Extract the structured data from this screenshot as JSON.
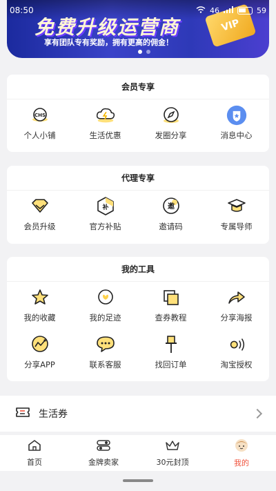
{
  "status_bar": {
    "time": "08:50",
    "signal_text": "46",
    "battery": "59"
  },
  "banner": {
    "title": "免费升级运营商",
    "subtitle": "享有团队专有奖励，拥有更高的佣金！",
    "badge": "VIP"
  },
  "sections": [
    {
      "title": "会员专享",
      "items": [
        {
          "label": "个人小铺",
          "icon": "shop-badge-icon"
        },
        {
          "label": "生活优惠",
          "icon": "cloud-lightning-icon"
        },
        {
          "label": "发圈分享",
          "icon": "compass-icon"
        },
        {
          "label": "消息中心",
          "icon": "message-shield-icon"
        }
      ]
    },
    {
      "title": "代理专享",
      "items": [
        {
          "label": "会员升级",
          "icon": "diamond-icon"
        },
        {
          "label": "官方补贴",
          "icon": "subsidy-hexagon-icon"
        },
        {
          "label": "邀请码",
          "icon": "invite-code-icon"
        },
        {
          "label": "专属导师",
          "icon": "graduation-cap-icon"
        }
      ]
    },
    {
      "title": "我的工具",
      "items": [
        {
          "label": "我的收藏",
          "icon": "star-icon"
        },
        {
          "label": "我的足迹",
          "icon": "footprint-icon"
        },
        {
          "label": "查券教程",
          "icon": "tutorial-squares-icon"
        },
        {
          "label": "分享海报",
          "icon": "share-arrow-icon"
        },
        {
          "label": "分享APP",
          "icon": "share-app-icon"
        },
        {
          "label": "联系客服",
          "icon": "chat-bubble-icon"
        },
        {
          "label": "找回订单",
          "icon": "pin-icon"
        },
        {
          "label": "淘宝授权",
          "icon": "broadcast-icon"
        }
      ]
    }
  ],
  "coupon": {
    "label": "生活券"
  },
  "nav": [
    {
      "label": "首页",
      "icon": "home-icon",
      "active": false
    },
    {
      "label": "金牌卖家",
      "icon": "toggle-icon",
      "active": false
    },
    {
      "label": "30元封顶",
      "icon": "crown-icon",
      "active": false
    },
    {
      "label": "我的",
      "icon": "profile-face-icon",
      "active": true
    }
  ],
  "colors": {
    "accent": "#f0523c",
    "icon_yellow": "#ffd24a",
    "banner_blue": "#2e39b8"
  }
}
